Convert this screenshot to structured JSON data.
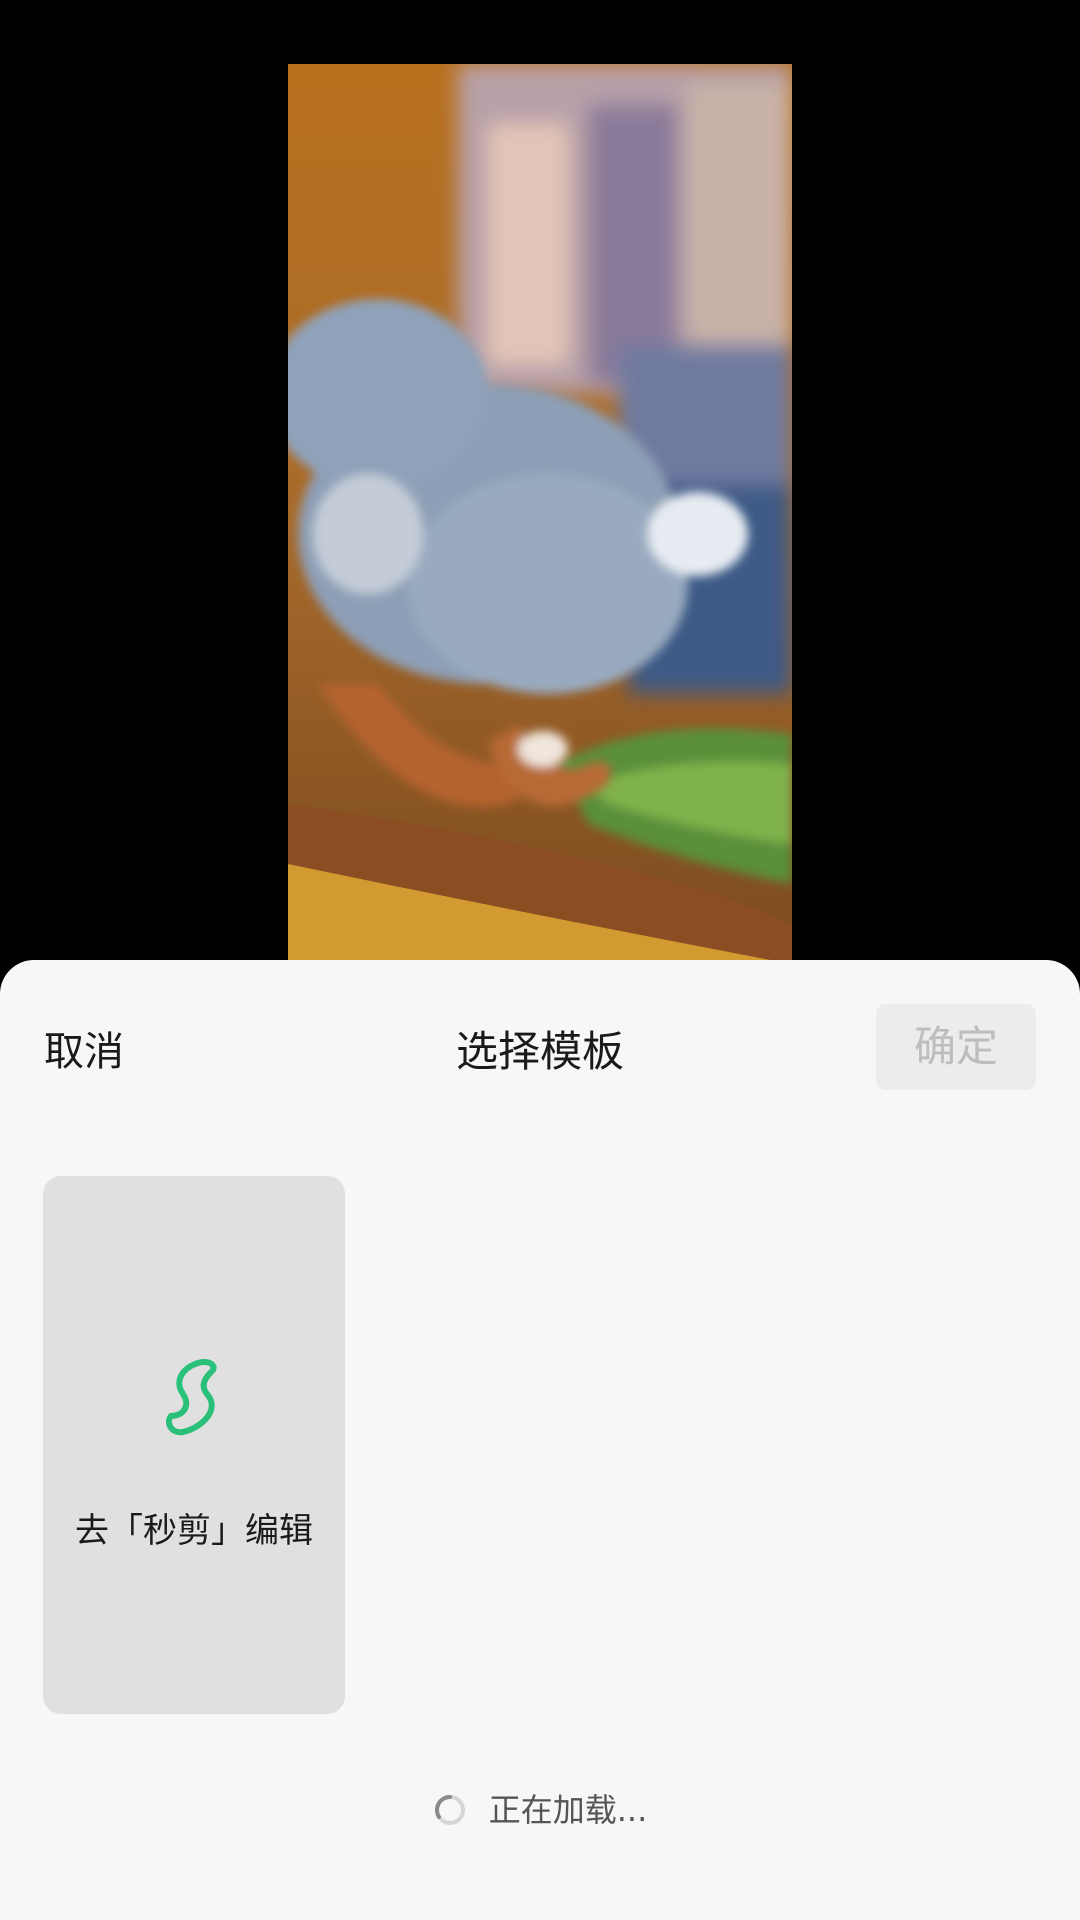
{
  "header": {
    "cancel_label": "取消",
    "title": "选择模板",
    "confirm_label": "确定"
  },
  "templates": [
    {
      "label": "去「秒剪」编辑",
      "icon": "miaojian-logo-icon"
    }
  ],
  "loading": {
    "text": "正在加载..."
  },
  "colors": {
    "sheet_background": "#f7f7f7",
    "card_background": "#e0e0e0",
    "confirm_disabled_background": "#ececec",
    "confirm_disabled_text": "#bdbdbd",
    "accent_green": "#2bc07a"
  }
}
